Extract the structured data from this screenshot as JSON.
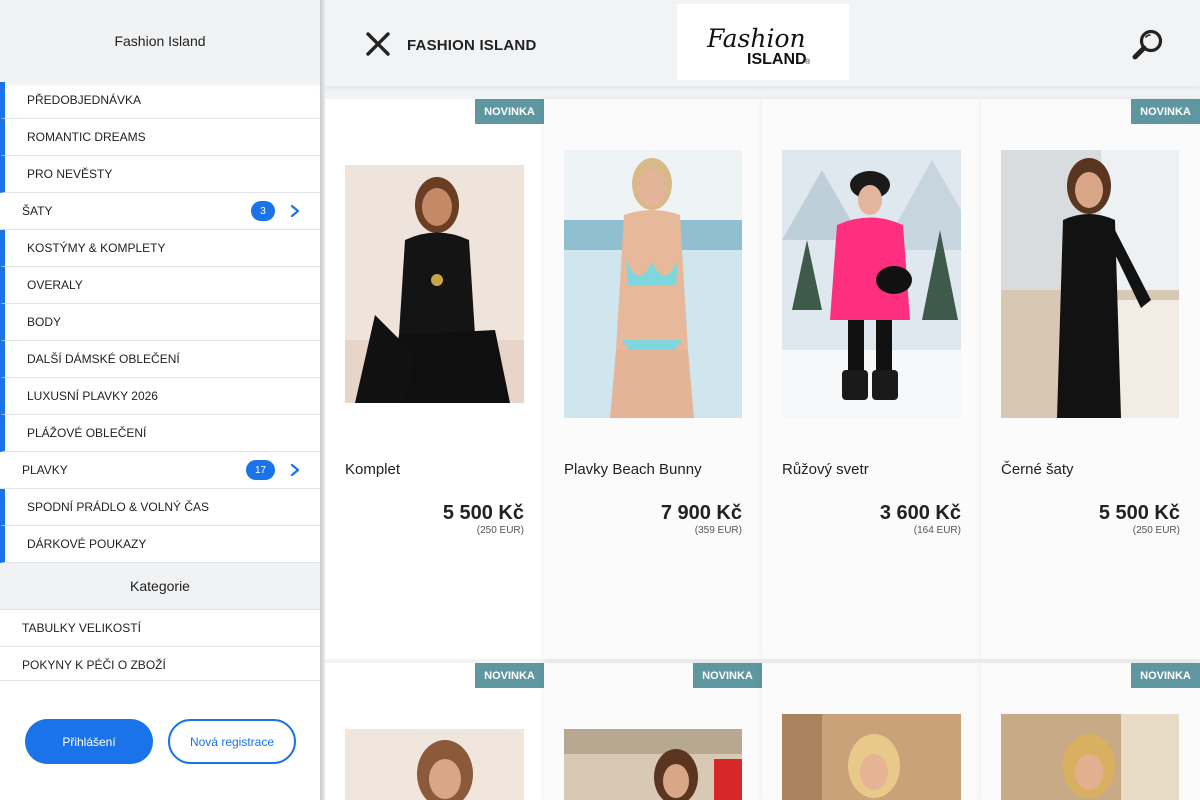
{
  "sidebar": {
    "header_title": "Fashion Island",
    "items": [
      {
        "label": "PŘEDOBJEDNÁVKA"
      },
      {
        "label": "ROMANTIC DREAMS"
      },
      {
        "label": "PRO NEVĚSTY"
      },
      {
        "label": "ŠATY",
        "badge": "3"
      },
      {
        "label": "KOSTÝMY & KOMPLETY"
      },
      {
        "label": "OVERALY"
      },
      {
        "label": "BODY"
      },
      {
        "label": "DALŠÍ DÁMSKÉ OBLEČENÍ"
      },
      {
        "label": "LUXUSNÍ PLAVKY 2026"
      },
      {
        "label": "PLÁŽOVÉ OBLEČENÍ"
      },
      {
        "label": "PLAVKY",
        "badge": "17"
      },
      {
        "label": "SPODNÍ PRÁDLO & VOLNÝ ČAS"
      },
      {
        "label": "DÁRKOVÉ POUKAZY"
      }
    ],
    "section_title": "Kategorie",
    "info_items": [
      {
        "label": "TABULKY VELIKOSTÍ"
      },
      {
        "label": "POKYNY K PÉČI O ZBOŽÍ"
      }
    ],
    "login_label": "Přihlášení",
    "register_label": "Nová registrace"
  },
  "topbar": {
    "title": "FASHION ISLAND",
    "logo_line1": "Fashion",
    "logo_line2": "ISLAND",
    "logo_mark": "®"
  },
  "products": [
    {
      "badge": "NOVINKA",
      "name": "Komplet",
      "price": "5 500 Kč",
      "eur": "(250 EUR)"
    },
    {
      "badge": "",
      "name": "Plavky Beach Bunny",
      "price": "7 900 Kč",
      "eur": "(359 EUR)"
    },
    {
      "badge": "",
      "name": "Růžový svetr",
      "price": "3 600 Kč",
      "eur": "(164 EUR)"
    },
    {
      "badge": "NOVINKA",
      "name": "Černé šaty",
      "price": "5 500 Kč",
      "eur": "(250 EUR)"
    },
    {
      "badge": "NOVINKA"
    },
    {
      "badge": "NOVINKA"
    },
    {
      "badge": ""
    },
    {
      "badge": "NOVINKA"
    }
  ],
  "colors": {
    "accent": "#1a73e8",
    "badge_new": "#5f97a0",
    "sidebar_header_bg": "#f1f2f3"
  }
}
